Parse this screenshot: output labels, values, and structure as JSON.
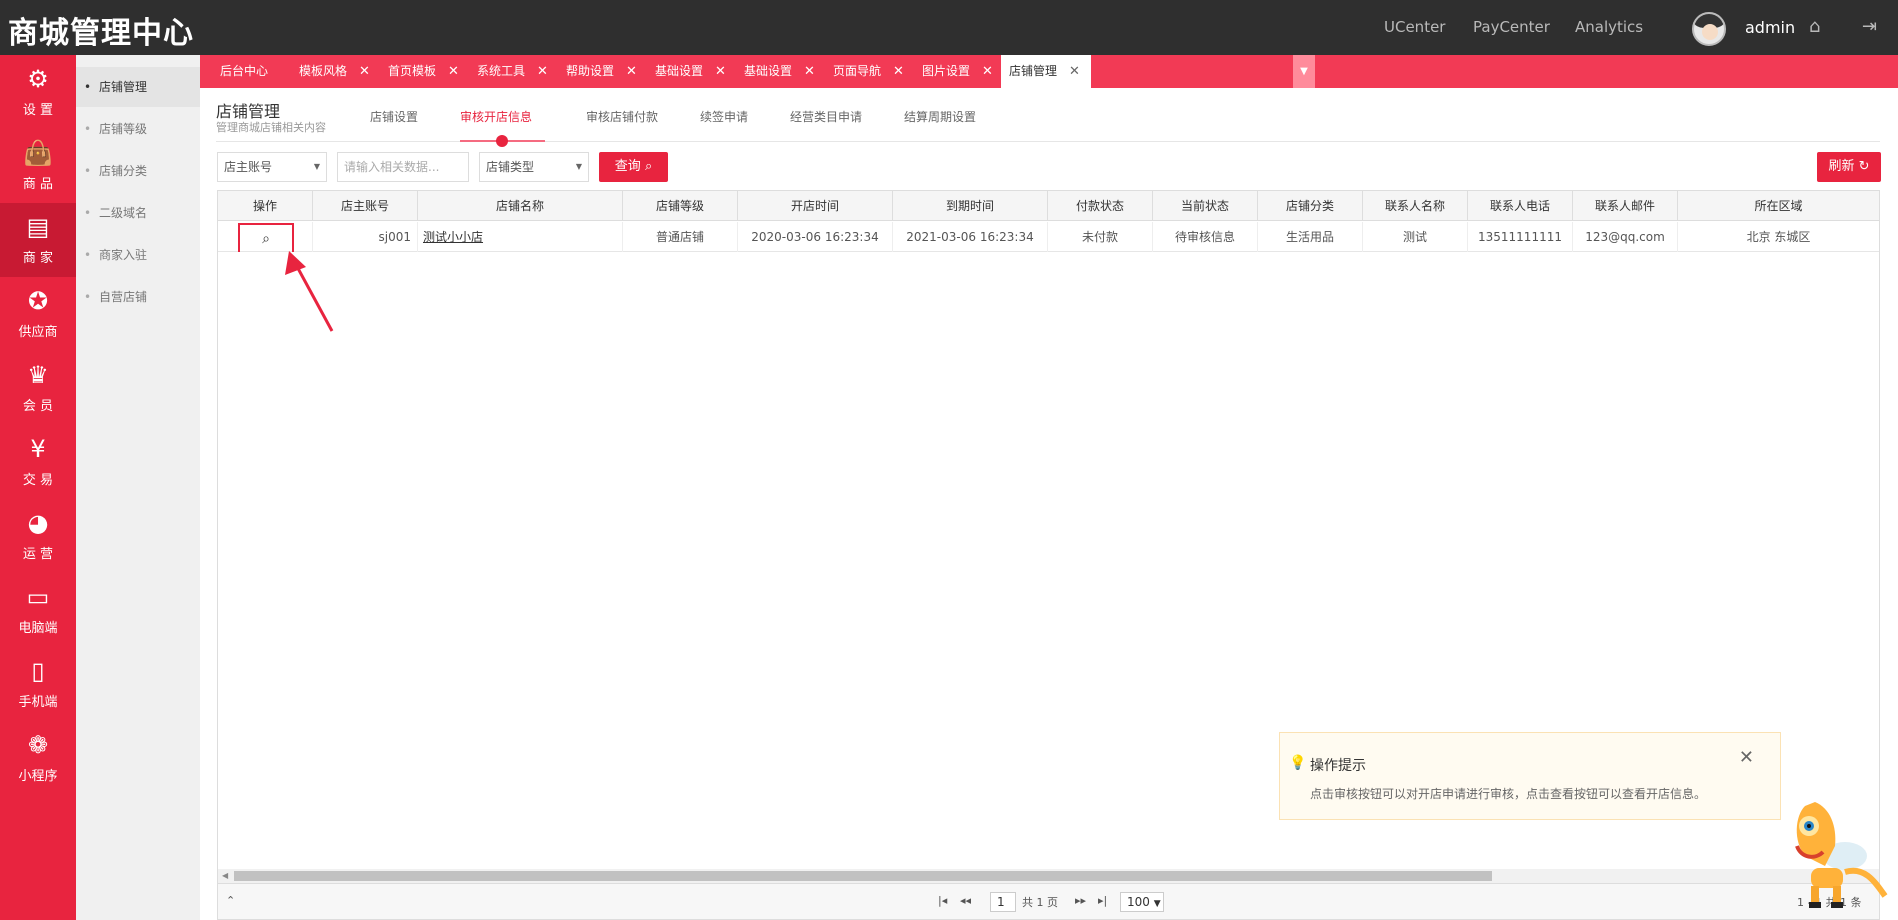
{
  "app": {
    "title": "商城管理中心",
    "user": "admin"
  },
  "topnav": [
    "UCenter",
    "PayCenter",
    "Analytics"
  ],
  "icons": {
    "home": "home-icon",
    "logout": "logout-icon"
  },
  "sidebar": [
    {
      "label": "设 置",
      "icon": "gear-icon",
      "glyph": "⚙"
    },
    {
      "label": "商 品",
      "icon": "bag-icon",
      "glyph": "🛍"
    },
    {
      "label": "商 家",
      "icon": "store-icon",
      "glyph": "🏪"
    },
    {
      "label": "供应商",
      "icon": "ribbon-icon",
      "glyph": "🎖"
    },
    {
      "label": "会 员",
      "icon": "crown-icon",
      "glyph": "♛"
    },
    {
      "label": "交 易",
      "icon": "yen-icon",
      "glyph": "¥"
    },
    {
      "label": "运 营",
      "icon": "pie-icon",
      "glyph": "◔"
    },
    {
      "label": "电脑端",
      "icon": "monitor-icon",
      "glyph": "🖥"
    },
    {
      "label": "手机端",
      "icon": "phone-icon",
      "glyph": "📱"
    },
    {
      "label": "小程序",
      "icon": "miniapp-icon",
      "glyph": "⚘"
    }
  ],
  "submenu": [
    "店铺管理",
    "店铺等级",
    "店铺分类",
    "二级域名",
    "商家入驻",
    "自营店铺"
  ],
  "tabs": [
    "后台中心",
    "模板风格",
    "首页模板",
    "系统工具",
    "帮助设置",
    "基础设置",
    "基础设置",
    "页面导航",
    "图片设置",
    "店铺管理"
  ],
  "page": {
    "title": "店铺管理",
    "subtitle": "管理商城店铺相关内容",
    "subtabs": [
      "店铺设置",
      "审核开店信息",
      "审核店铺付款",
      "续签申请",
      "经营类目申请",
      "结算周期设置"
    ]
  },
  "search": {
    "field_select": "店主账号",
    "keyword_placeholder": "请输入相关数据...",
    "type_select": "店铺类型",
    "query_label": "查询",
    "refresh_label": "刷新"
  },
  "table": {
    "columns": [
      "操作",
      "店主账号",
      "店铺名称",
      "店铺等级",
      "开店时间",
      "到期时间",
      "付款状态",
      "当前状态",
      "店铺分类",
      "联系人名称",
      "联系人电话",
      "联系人邮件",
      "所在区域"
    ],
    "rows": [
      [
        "",
        "sj001",
        "测试小小店",
        "普通店铺",
        "2020-03-06 16:23:34",
        "2021-03-06 16:23:34",
        "未付款",
        "待审核信息",
        "生活用品",
        "测试",
        "13511111111",
        "123@qq.com",
        "北京 东城区"
      ]
    ]
  },
  "pager": {
    "page_value": "1",
    "total_pages_text": "共 1 页",
    "page_size": "100",
    "summary": "1 - 1 共 1 条"
  },
  "tips": {
    "title": "操作提示",
    "text": "点击审核按钮可以对开店申请进行审核，点击查看按钮可以查看开店信息。"
  },
  "colors": {
    "primary": "#e8243f",
    "topbar": "#2f2f2f",
    "tabstrip": "#f23a55"
  }
}
